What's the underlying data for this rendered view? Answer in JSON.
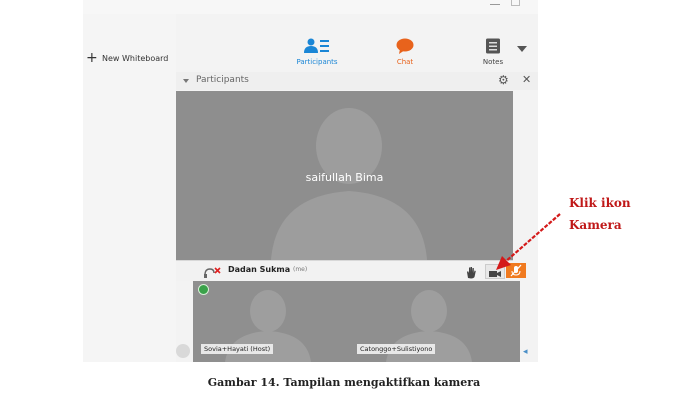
{
  "sidebar": {
    "new_whiteboard_label": "New Whiteboard"
  },
  "tabs": [
    {
      "label": "Participants",
      "icon": "participants-icon",
      "active": true
    },
    {
      "label": "Chat",
      "icon": "chat-bubble-icon",
      "active": false
    },
    {
      "label": "Notes",
      "icon": "notes-icon",
      "active": false
    }
  ],
  "panel": {
    "title": "Participants"
  },
  "main_video": {
    "name": "saifullah Bima"
  },
  "self_row": {
    "name": "Dadan Sukma",
    "me_tag": "(me)"
  },
  "thumbnails": [
    {
      "label": "Sovia+Hayati (Host)"
    },
    {
      "label": "Catonggo+Sulistiyono"
    }
  ],
  "annotation": {
    "line1": "Klik ikon",
    "line2": "Kamera"
  },
  "caption": "Gambar 14. Tampilan mengaktifkan kamera",
  "colors": {
    "accent_blue": "#1a86d6",
    "chat_orange": "#e8631c",
    "mic_orange": "#f07a1f",
    "annotation_red": "#c01818"
  }
}
